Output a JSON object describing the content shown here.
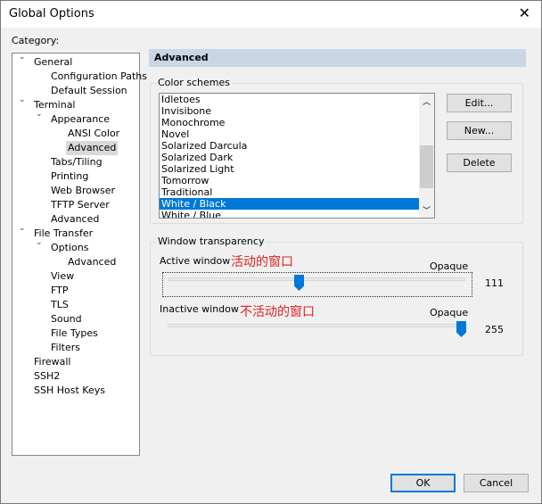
{
  "window": {
    "title": "Global Options",
    "close_icon": "close-icon"
  },
  "category_label": "Category:",
  "tree": [
    {
      "label": "General",
      "level": 0,
      "expanded": true
    },
    {
      "label": "Configuration Paths",
      "level": 1
    },
    {
      "label": "Default Session",
      "level": 1
    },
    {
      "label": "Terminal",
      "level": 0,
      "expanded": true
    },
    {
      "label": "Appearance",
      "level": 1,
      "expanded": true
    },
    {
      "label": "ANSI Color",
      "level": 2
    },
    {
      "label": "Advanced",
      "level": 2,
      "selected": true
    },
    {
      "label": "Tabs/Tiling",
      "level": 1
    },
    {
      "label": "Printing",
      "level": 1
    },
    {
      "label": "Web Browser",
      "level": 1
    },
    {
      "label": "TFTP Server",
      "level": 1
    },
    {
      "label": "Advanced",
      "level": 1
    },
    {
      "label": "File Transfer",
      "level": 0,
      "expanded": true
    },
    {
      "label": "Options",
      "level": 1,
      "expanded": true
    },
    {
      "label": "Advanced",
      "level": 2
    },
    {
      "label": "View",
      "level": 1
    },
    {
      "label": "FTP",
      "level": 1
    },
    {
      "label": "TLS",
      "level": 1
    },
    {
      "label": "Sound",
      "level": 1
    },
    {
      "label": "File Types",
      "level": 1
    },
    {
      "label": "Filters",
      "level": 1
    },
    {
      "label": "Firewall",
      "level": 0
    },
    {
      "label": "SSH2",
      "level": 0
    },
    {
      "label": "SSH Host Keys",
      "level": 0
    }
  ],
  "panel": {
    "header": "Advanced",
    "color_schemes": {
      "label": "Color schemes",
      "items": [
        "Idletoes",
        "Invisibone",
        "Monochrome",
        "Novel",
        "Solarized Darcula",
        "Solarized Dark",
        "Solarized Light",
        "Tomorrow",
        "Traditional",
        "White / Black",
        "White / Blue"
      ],
      "selected": "White / Black",
      "edit": "Edit...",
      "new": "New...",
      "delete": "Delete"
    },
    "transparency": {
      "label": "Window transparency",
      "active": {
        "label": "Active window",
        "annotation": "活动的窗口",
        "opaque": "Opaque",
        "value": 111,
        "min": 0,
        "max": 255
      },
      "inactive": {
        "label": "Inactive window",
        "annotation": "不活动的窗口",
        "opaque": "Opaque",
        "value": 255,
        "min": 0,
        "max": 255
      }
    }
  },
  "buttons": {
    "ok": "OK",
    "cancel": "Cancel"
  },
  "colors": {
    "accent": "#0078d7",
    "annotation": "#e02020",
    "header_bg": "#c9d6e3"
  }
}
